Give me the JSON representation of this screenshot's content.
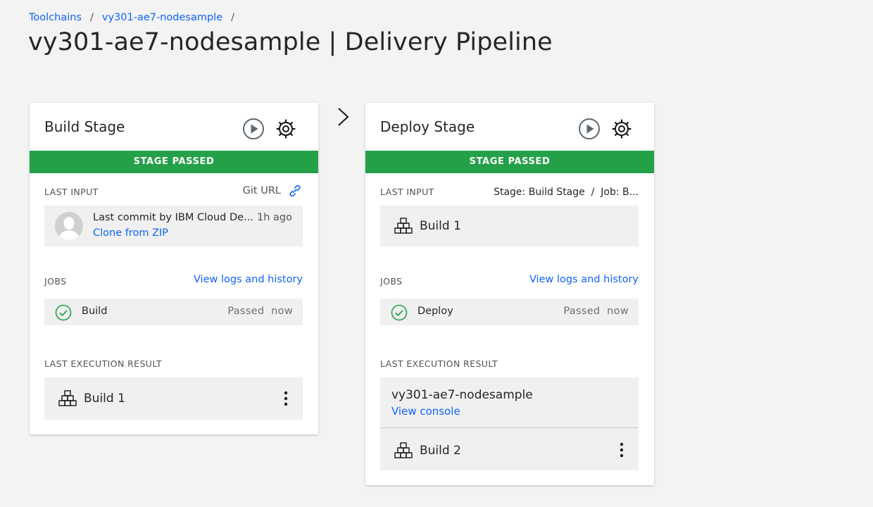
{
  "breadcrumb": {
    "items": [
      "Toolchains",
      "vy301-ae7-nodesample"
    ],
    "separator": "/"
  },
  "page_title": "vy301-ae7-nodesample | Delivery Pipeline",
  "colors": {
    "passed": "#24a148",
    "link": "#0f62fe",
    "background": "#f3f3f3"
  },
  "build_stage": {
    "title": "Build Stage",
    "status": "STAGE PASSED",
    "last_input_label": "LAST INPUT",
    "input_source": "Git URL",
    "commit_text": "Last commit by IBM Cloud De...",
    "commit_time": "1h ago",
    "commit_link": "Clone from ZIP",
    "jobs_label": "JOBS",
    "logs_link": "View logs and history",
    "job_name": "Build",
    "job_status": "Passed  now",
    "result_label": "LAST EXECUTION RESULT",
    "result_build": "Build 1"
  },
  "deploy_stage": {
    "title": "Deploy Stage",
    "status": "STAGE PASSED",
    "last_input_label": "LAST INPUT",
    "input_source": "Stage: Build Stage  /  Job: B...",
    "input_build": "Build 1",
    "jobs_label": "JOBS",
    "logs_link": "View logs and history",
    "job_name": "Deploy",
    "job_status": "Passed  now",
    "result_label": "LAST EXECUTION RESULT",
    "app_name": "vy301-ae7-nodesample",
    "console_link": "View console",
    "result_build": "Build 2"
  },
  "icons": [
    "play-icon",
    "gear-icon",
    "link-icon",
    "avatar-icon",
    "checkmark-icon",
    "build-icon",
    "overflow-menu-icon",
    "chevron-right-icon"
  ]
}
